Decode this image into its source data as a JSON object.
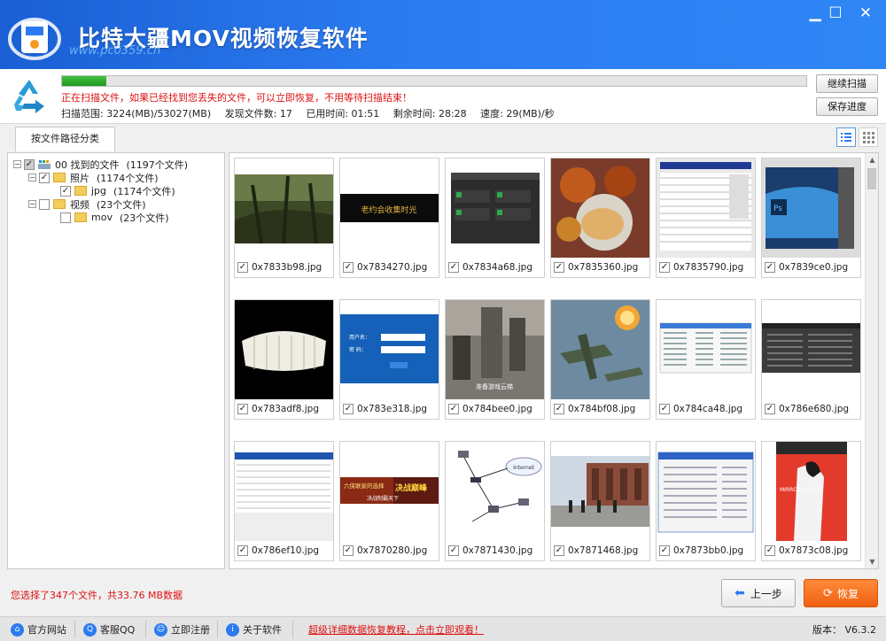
{
  "app": {
    "title": "比特大疆MOV视频恢复软件",
    "watermark": "www.pc0359.cn",
    "min_glyph": "▁",
    "max_glyph": "☐",
    "close_glyph": "✕"
  },
  "scan": {
    "progress_percent": 6,
    "message": "正在扫描文件，如果已经找到您丢失的文件，可以立即恢复，不用等待扫描结束！",
    "range": "扫描范围: 3224(MB)/53027(MB)",
    "found": "发现文件数: 17",
    "elapsed": "已用时间: 01:51",
    "remaining": "剩余时间: 28:28",
    "speed": "速度: 29(MB)/秒",
    "continue_label": "继续扫描",
    "save_label": "保存进度"
  },
  "tabs": {
    "active": "按文件路径分类"
  },
  "tree": {
    "root": {
      "label": "00 找到的文件",
      "count": "(1197个文件)"
    },
    "photo": {
      "label": "照片",
      "count": "(1174个文件)"
    },
    "jpg": {
      "label": "jpg",
      "count": "(1174个文件)"
    },
    "video": {
      "label": "视频",
      "count": "(23个文件)"
    },
    "mov": {
      "label": "mov",
      "count": "(23个文件)"
    }
  },
  "files": [
    {
      "name": "0x7833b98.jpg",
      "thumb": "forest"
    },
    {
      "name": "0x7834270.jpg",
      "thumb": "dark-banner"
    },
    {
      "name": "0x7834a68.jpg",
      "thumb": "dialog"
    },
    {
      "name": "0x7835360.jpg",
      "thumb": "food"
    },
    {
      "name": "0x7835790.jpg",
      "thumb": "spreadsheet"
    },
    {
      "name": "0x7839ce0.jpg",
      "thumb": "photoshop"
    },
    {
      "name": "0x783adf8.jpg",
      "thumb": "teeth"
    },
    {
      "name": "0x783e318.jpg",
      "thumb": "login"
    },
    {
      "name": "0x784bee0.jpg",
      "thumb": "game-ruins"
    },
    {
      "name": "0x784bf08.jpg",
      "thumb": "planes"
    },
    {
      "name": "0x784ca48.jpg",
      "thumb": "filelist"
    },
    {
      "name": "0x786e680.jpg",
      "thumb": "dark-app"
    },
    {
      "name": "0x786ef10.jpg",
      "thumb": "table"
    },
    {
      "name": "0x7870280.jpg",
      "thumb": "game-banner"
    },
    {
      "name": "0x7871430.jpg",
      "thumb": "network"
    },
    {
      "name": "0x7871468.jpg",
      "thumb": "campus"
    },
    {
      "name": "0x7873bb0.jpg",
      "thumb": "window"
    },
    {
      "name": "0x7873c08.jpg",
      "thumb": "game-cover"
    }
  ],
  "thumb_text": {
    "dark_banner": "老约会收集时光",
    "login_user": "用户名：",
    "login_pass": "密 码：",
    "game_ruins": "准备游戏云梯",
    "game_banner_a": "六侠联家的选择",
    "game_banner_b": "决战巅峰",
    "game_banner_c": "决战制霸天下",
    "network_cloud": "Internet",
    "game_cover": "MIRROR'S EDGE"
  },
  "bottom": {
    "selected_info": "您选择了347个文件，共33.76 MB数据",
    "prev_label": "上一步",
    "recover_label": "恢复"
  },
  "footer": {
    "site": "官方网站",
    "qq": "客服QQ",
    "register": "立即注册",
    "about": "关于软件",
    "tutorial": "超级详细数据恢复教程，点击立即观看！",
    "version": "版本：  V6.3.2"
  },
  "colors": {
    "title_bg": "#2b7bf0",
    "progress": "#2eae2e",
    "warning": "#dd1111",
    "recover": "#f06010"
  }
}
